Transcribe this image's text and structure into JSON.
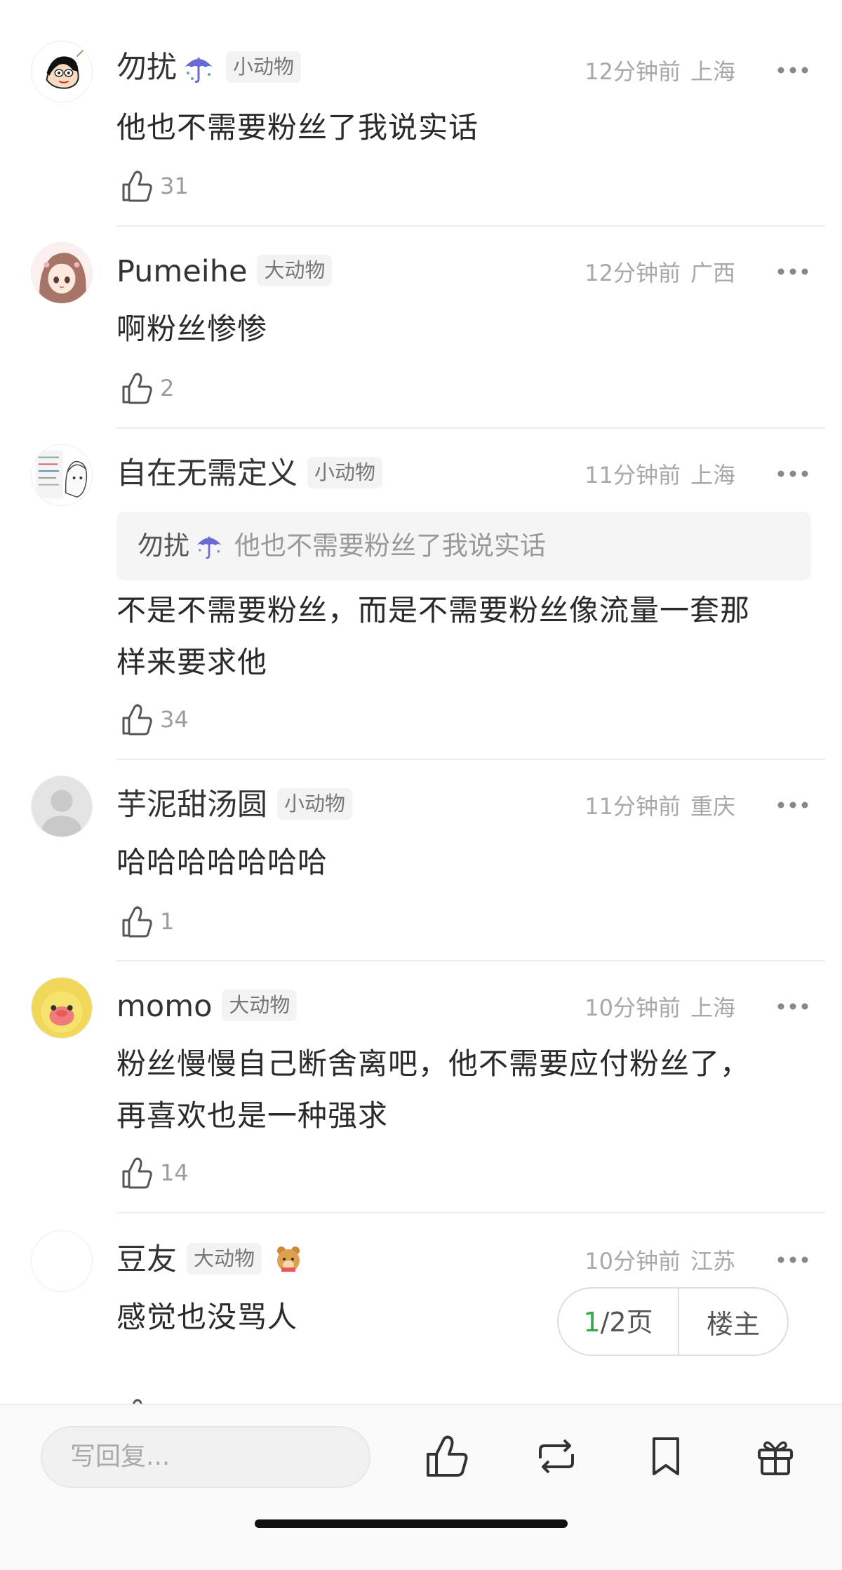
{
  "comments": [
    {
      "name": "勿扰",
      "badge": "小动物",
      "time": "12分钟前",
      "location": "上海",
      "text": "他也不需要粉丝了我说实话",
      "likes": "31"
    },
    {
      "name": "Pumeihe",
      "badge": "大动物",
      "time": "12分钟前",
      "location": "广西",
      "text": "啊粉丝惨惨",
      "likes": "2"
    },
    {
      "name": "自在无需定义",
      "badge": "小动物",
      "time": "11分钟前",
      "location": "上海",
      "quote_name": "勿扰",
      "quote_text": "他也不需要粉丝了我说实话",
      "text_line1": "不是不需要粉丝，而是不需要粉丝像流量一套那",
      "text_line2": "样来要求他",
      "likes": "34"
    },
    {
      "name": "芋泥甜汤圆",
      "badge": "小动物",
      "time": "11分钟前",
      "location": "重庆",
      "text": "哈哈哈哈哈哈哈",
      "likes": "1"
    },
    {
      "name": "momo",
      "badge": "大动物",
      "time": "10分钟前",
      "location": "上海",
      "text_line1": "粉丝慢慢自己断舍离吧，他不需要应付粉丝了，",
      "text_line2": "再喜欢也是一种强求",
      "likes": "14"
    },
    {
      "name": "豆友",
      "badge": "大动物",
      "time": "10分钟前",
      "location": "江苏",
      "text": "感觉也没骂人",
      "likes": ""
    }
  ],
  "pager": {
    "current": "1",
    "rest": "/2页",
    "op_label": "楼主"
  },
  "bottom": {
    "reply_placeholder": "写回复..."
  },
  "colors": {
    "accent_green": "#2daa4b",
    "meta_gray": "#a8a8a8",
    "badge_bg": "#f3f3f3"
  }
}
